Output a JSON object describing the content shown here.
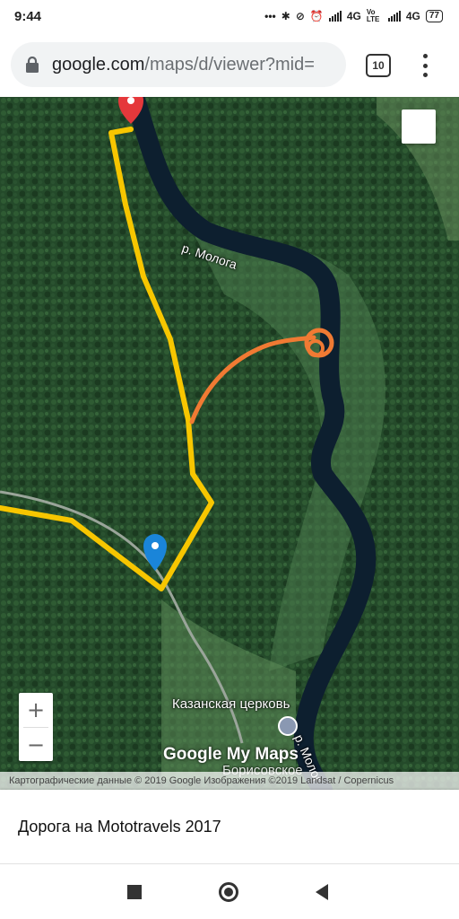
{
  "status_bar": {
    "time": "9:44",
    "dots": "•••",
    "net1": "4G",
    "volte": "Vo LTE",
    "net2": "4G",
    "battery": "77"
  },
  "browser": {
    "url_host": "google.com",
    "url_path": "/maps/d/viewer?mid=",
    "tab_count": "10"
  },
  "map": {
    "labels": {
      "river_top": "р. Молога",
      "river_bottom": "р. Молог",
      "church": "Казанская церковь",
      "village": "Борисовское"
    },
    "logo": "Google My Maps",
    "attribution": "Картографические данные © 2019 Google Изображения ©2019 Landsat / Copernicus",
    "zoom_in_label": "+",
    "zoom_out_label": "−",
    "colors": {
      "route_yellow": "#f7c600",
      "route_orange": "#f07a33",
      "marker_red": "#e5383b",
      "marker_blue": "#1a85d9",
      "river": "#0d1f2f"
    }
  },
  "title": "Дорога на Mototravels 2017"
}
